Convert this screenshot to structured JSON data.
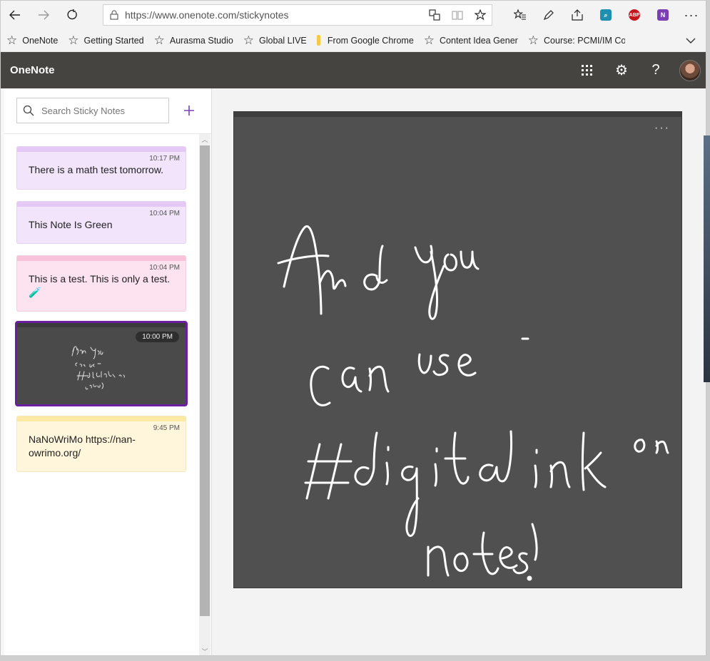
{
  "browser": {
    "url": "https://www.onenote.com/stickynotes",
    "buttons": {
      "back": "back-arrow-icon",
      "forward": "forward-arrow-icon",
      "refresh": "refresh-icon"
    },
    "extensions": {
      "adblock": "ABP",
      "onenote": "N"
    }
  },
  "favorites": [
    {
      "label": "OneNote",
      "icon": "star-icon"
    },
    {
      "label": "Getting Started",
      "icon": "star-icon"
    },
    {
      "label": "Aurasma Studio",
      "icon": "star-icon"
    },
    {
      "label": "Global LIVE",
      "icon": "star-icon"
    },
    {
      "label": "From Google Chrome",
      "icon": "folder-icon"
    },
    {
      "label": "Content Idea Generat",
      "icon": "star-icon"
    },
    {
      "label": "Course: PCMI/IM Cor",
      "icon": "star-icon"
    }
  ],
  "app": {
    "name": "OneNote"
  },
  "sidebar": {
    "search_placeholder": "Search Sticky Notes",
    "notes": [
      {
        "time": "10:17 PM",
        "text": "There is a math test tomorrow.",
        "color": "#f1e4fb"
      },
      {
        "time": "10:04 PM",
        "text": "This Note Is Green",
        "color": "#f1e4fb"
      },
      {
        "time": "10:04 PM",
        "text": "This is a test.  This is only a test.",
        "color": "#fde2ef",
        "emoji": "🧪"
      },
      {
        "time": "10:00 PM",
        "ink": true,
        "color": "#4a4a4a"
      },
      {
        "time": "9:45 PM",
        "text": "NaNoWriMo https://nan-owrimo.org/",
        "color": "#fff6db"
      }
    ]
  },
  "main": {
    "more_label": "···",
    "ink_note": "And you can use #digitalink on notes!"
  },
  "colors": {
    "header": "#464441",
    "selected_border": "#6b1fa0",
    "accent": "#7b3fb3"
  }
}
